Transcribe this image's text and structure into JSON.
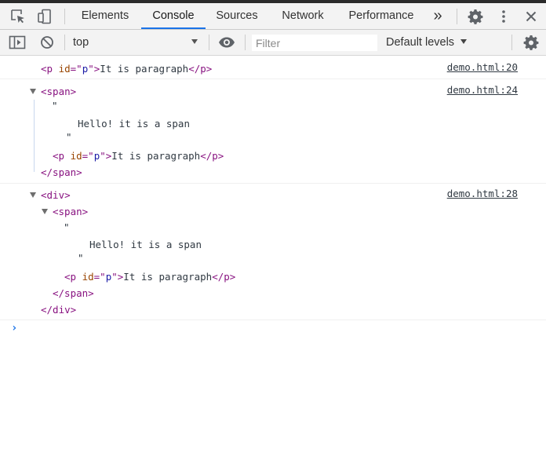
{
  "tabs": {
    "elements": "Elements",
    "console": "Console",
    "sources": "Sources",
    "network": "Network",
    "performance": "Performance",
    "more": "»"
  },
  "toolbar": {
    "context": "top",
    "filter_placeholder": "Filter",
    "levels": "Default levels"
  },
  "messages": [
    {
      "source": "demo.html:20",
      "p_open": "<p",
      "attr": " id",
      "eq": "=\"",
      "val": "p",
      "close_q": "\">",
      "text": "It is paragraph",
      "p_close": "</p>"
    },
    {
      "source": "demo.html:24",
      "span_open": "<span>",
      "quote_open": "\"",
      "text_node": "Hello! it is a span",
      "quote_close": "\"",
      "p_open": "<p",
      "attr": " id",
      "eq": "=\"",
      "val": "p",
      "close_q": "\">",
      "p_text": "It is paragraph",
      "p_close": "</p>",
      "span_close": "</span>"
    },
    {
      "source": "demo.html:28",
      "div_open": "<div>",
      "span_open": "<span>",
      "quote_open": "\"",
      "text_node": "Hello! it is a span",
      "quote_close": "\"",
      "p_open": "<p",
      "attr": " id",
      "eq": "=\"",
      "val": "p",
      "close_q": "\">",
      "p_text": "It is paragraph",
      "p_close": "</p>",
      "span_close": "</span>",
      "div_close": "</div>"
    }
  ],
  "prompt": "›",
  "icons": {
    "inspect": "inspect-element-icon",
    "device": "device-toolbar-icon",
    "settings": "gear-icon",
    "menu": "kebab-menu-icon",
    "close": "close-icon",
    "sidebar": "sidebar-toggle-icon",
    "clear": "clear-console-icon",
    "eye": "live-expression-eye-icon"
  }
}
